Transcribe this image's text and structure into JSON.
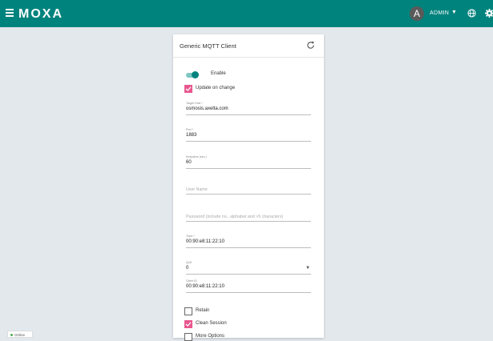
{
  "header": {
    "logo": "MOXA",
    "avatar_letter": "A",
    "user": "ADMIN",
    "caret": "▼",
    "brand_color": "#00837d"
  },
  "card": {
    "title": "Generic MQTT Client",
    "enable_label": "Enable",
    "update_on_change_label": "Update on change",
    "target_host": {
      "label": "Target Host *",
      "value": "osmosis.axelta.com"
    },
    "port": {
      "label": "Port *",
      "value": "1883"
    },
    "keepalive": {
      "label": "Keepalive (sec.)",
      "value": "60"
    },
    "username": {
      "placeholder": "User Name"
    },
    "password": {
      "placeholder": "Password (include no., alphabet and >5 characters)"
    },
    "topic": {
      "label": "Topic *",
      "value": "00:90:e8:11:22:10"
    },
    "qos": {
      "label": "QoS",
      "value": "0",
      "caret": "▼"
    },
    "client_id": {
      "label": "Client ID",
      "value": "00:90:e8:11:22:10"
    },
    "retain_label": "Retain",
    "clean_session_label": "Clean Session",
    "more_options_label": "More Options"
  },
  "status": {
    "text": "Online"
  },
  "colors": {
    "accent_pink": "#e8588f",
    "toggle": "#00837d",
    "background": "#e3e8ec"
  }
}
